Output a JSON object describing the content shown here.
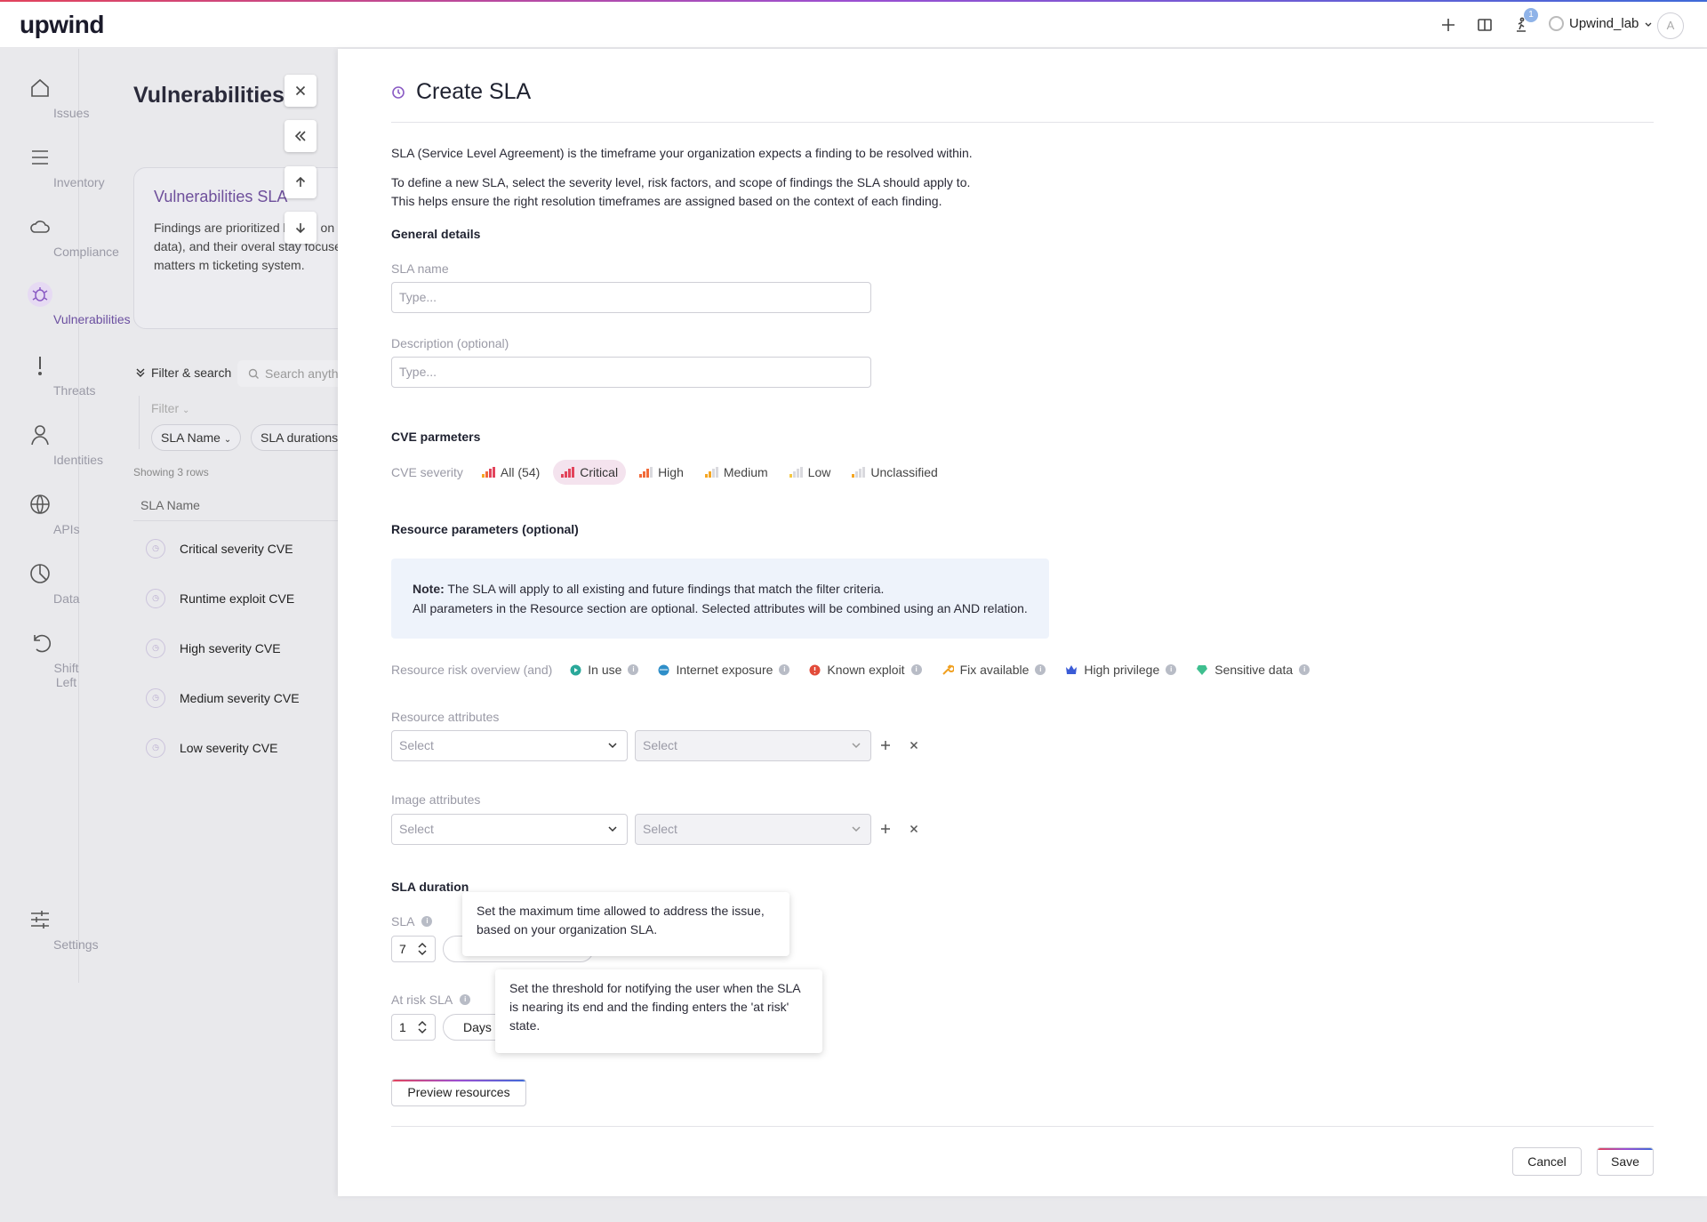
{
  "app": {
    "logo": "upwind"
  },
  "topbar": {
    "notification_count": "1",
    "org_name": "Upwind_lab",
    "avatar_letter": "A"
  },
  "sidebar": {
    "items": [
      {
        "label": "Issues"
      },
      {
        "label": "Inventory"
      },
      {
        "label": "Compliance"
      },
      {
        "label": "Vulnerabilities"
      },
      {
        "label": "Threats"
      },
      {
        "label": "Identities"
      },
      {
        "label": "APIs"
      },
      {
        "label": "Data"
      },
      {
        "label": "Shift Left"
      },
      {
        "label": "Settings"
      }
    ],
    "active": "Vulnerabilities"
  },
  "background": {
    "title": "Vulnerabilities",
    "card_title": "Vulnerabilities SLA",
    "card_text": "Findings are prioritized based on ass sensitive data), and their overal stay focused on what matters m ticketing system.",
    "filter_search": "Filter & search",
    "search_placeholder": "Search anyth",
    "filter_label": "Filter",
    "pill_sla_name": "SLA Name",
    "pill_sla_durations": "SLA durations",
    "showing": "Showing 3 rows",
    "column_header": "SLA Name",
    "rows": [
      {
        "name": "Critical severity CVE"
      },
      {
        "name": "Runtime exploit CVE"
      },
      {
        "name": "High severity CVE"
      },
      {
        "name": "Medium severity CVE"
      },
      {
        "name": "Low severity CVE"
      }
    ]
  },
  "modal": {
    "title": "Create SLA",
    "intro1": "SLA (Service Level Agreement) is the timeframe your organization expects a finding to be resolved within.",
    "intro2": "To define a new SLA, select the severity level, risk factors, and scope of findings the SLA should apply to.",
    "intro3": "This helps ensure the right resolution timeframes are assigned based on the context of each finding.",
    "general_details": "General details",
    "sla_name_label": "SLA name",
    "sla_name_placeholder": "Type...",
    "description_label": "Description (optional)",
    "description_placeholder": "Type...",
    "cve_parameters": "CVE parmeters",
    "cve_severity_label": "CVE severity",
    "severities": [
      {
        "label": "All (54)",
        "color": "#e2445c"
      },
      {
        "label": "Critical",
        "color": "#e2445c"
      },
      {
        "label": "High",
        "color": "#f26b3a"
      },
      {
        "label": "Medium",
        "color": "#f5a623"
      },
      {
        "label": "Low",
        "color": "#f5c842"
      },
      {
        "label": "Unclassified",
        "color": "#f5a623"
      }
    ],
    "selected_severity": "Critical",
    "resource_parameters": "Resource parameters (optional)",
    "note_bold": "Note:",
    "note_line1": " The SLA will apply to all existing and future findings that match the filter criteria.",
    "note_line2": "All parameters in the Resource section are optional. Selected attributes will be combined using an AND relation.",
    "risk_overview_label": "Resource risk overview (and)",
    "risks": [
      {
        "label": "In use",
        "icon": "play-icon",
        "color": "#2aa89a"
      },
      {
        "label": "Internet exposure",
        "icon": "globe-icon",
        "color": "#2f8fc9"
      },
      {
        "label": "Known exploit",
        "icon": "exploit-icon",
        "color": "#e24b3a"
      },
      {
        "label": "Fix available",
        "icon": "wrench-icon",
        "color": "#f0a020"
      },
      {
        "label": "High privilege",
        "icon": "crown-icon",
        "color": "#3a5bd6"
      },
      {
        "label": "Sensitive data",
        "icon": "gem-icon",
        "color": "#3fbf8f"
      }
    ],
    "resource_attributes_label": "Resource attributes",
    "image_attributes_label": "Image attributes",
    "select_placeholder": "Select",
    "sla_duration": "SLA duration",
    "sla_label": "SLA",
    "sla_value": "7",
    "at_risk_label": "At risk SLA",
    "at_risk_value": "1",
    "days_label": "Days",
    "tooltip_sla": "Set the maximum time allowed to address the issue, based on your organization SLA.",
    "tooltip_at_risk": "Set the threshold for notifying the user when the SLA is nearing its end and the finding enters the 'at risk' state.",
    "preview_button": "Preview resources",
    "cancel_button": "Cancel",
    "save_button": "Save"
  }
}
